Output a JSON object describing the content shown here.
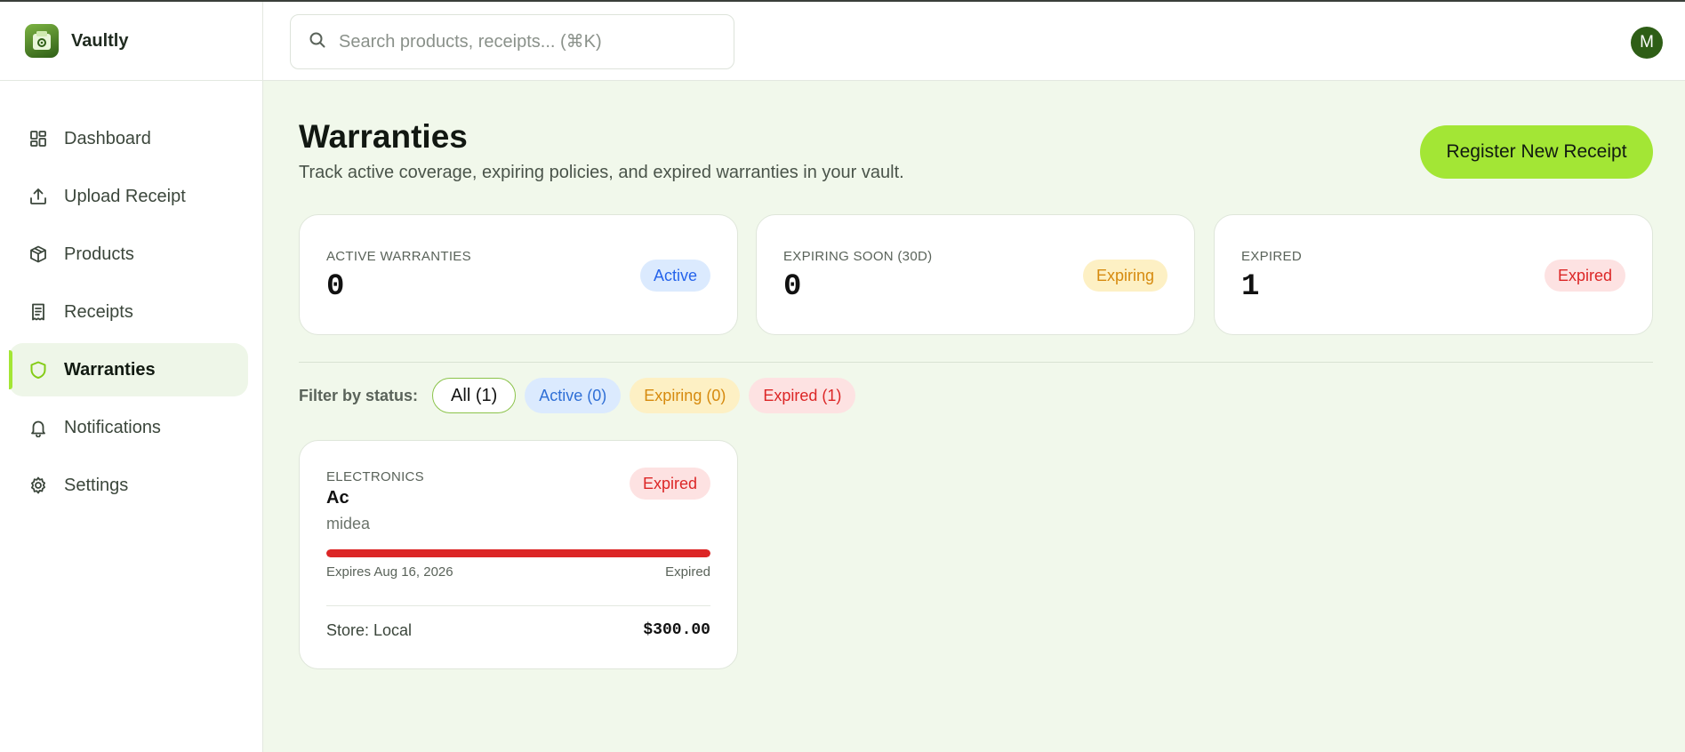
{
  "app": {
    "name": "Vaultly"
  },
  "search": {
    "placeholder": "Search products, receipts... (⌘K)"
  },
  "user": {
    "avatar_initial": "M"
  },
  "sidebar": {
    "items": [
      {
        "label": "Dashboard",
        "icon": "dashboard-icon",
        "active": false
      },
      {
        "label": "Upload Receipt",
        "icon": "upload-icon",
        "active": false
      },
      {
        "label": "Products",
        "icon": "box-icon",
        "active": false
      },
      {
        "label": "Receipts",
        "icon": "receipt-icon",
        "active": false
      },
      {
        "label": "Warranties",
        "icon": "shield-icon",
        "active": true
      },
      {
        "label": "Notifications",
        "icon": "bell-icon",
        "active": false
      },
      {
        "label": "Settings",
        "icon": "gear-icon",
        "active": false
      }
    ]
  },
  "page": {
    "title": "Warranties",
    "subtitle": "Track active coverage, expiring policies, and expired warranties in your vault.",
    "register_label": "Register New Receipt"
  },
  "stats": [
    {
      "label": "ACTIVE WARRANTIES",
      "value": "0",
      "badge": "Active"
    },
    {
      "label": "EXPIRING SOON (30D)",
      "value": "0",
      "badge": "Expiring"
    },
    {
      "label": "EXPIRED",
      "value": "1",
      "badge": "Expired"
    }
  ],
  "filters": {
    "label": "Filter by status:",
    "chips": [
      {
        "label": "All (1)",
        "selected": true
      },
      {
        "label": "Active (0)",
        "selected": false
      },
      {
        "label": "Expiring (0)",
        "selected": false
      },
      {
        "label": "Expired (1)",
        "selected": false
      }
    ]
  },
  "warranties": [
    {
      "category": "ELECTRONICS",
      "name": "Ac",
      "brand": "midea",
      "status": "Expired",
      "progress": 1.0,
      "expires": "Expires Aug 16, 2026",
      "expiry_status": "Expired",
      "store": "Store: Local",
      "price": "$300.00"
    }
  ],
  "colors": {
    "accent": "#a3e635",
    "brand_dark": "#2e5e16",
    "main_bg": "#f1f8eb",
    "active": "#2563eb",
    "expiring": "#d68a0e",
    "expired": "#dc2626"
  }
}
